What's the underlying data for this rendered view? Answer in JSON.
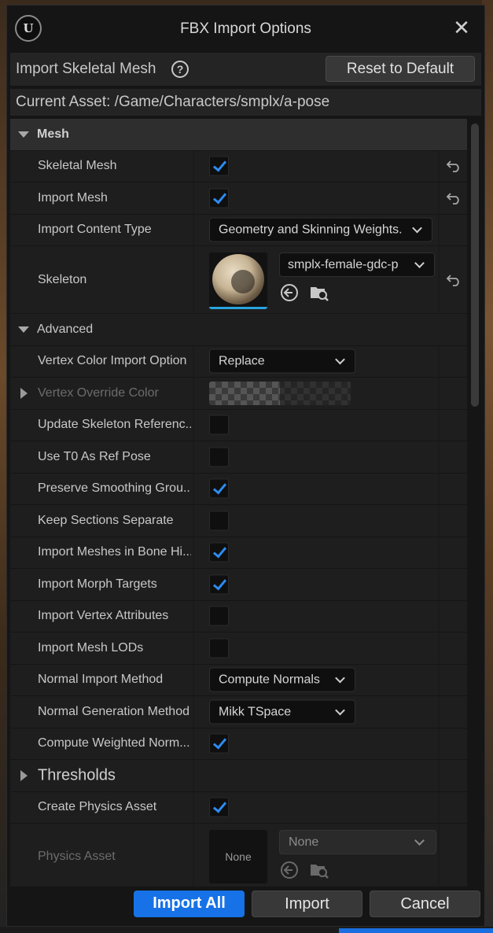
{
  "window": {
    "title": "FBX Import Options",
    "logo_letter": "U"
  },
  "header": {
    "title": "Import Skeletal Mesh",
    "reset_label": "Reset to Default"
  },
  "asset": {
    "label": "Current Asset:",
    "path": "/Game/Characters/smplx/a-pose",
    "text": "Current Asset:  /Game/Characters/smplx/a-pose"
  },
  "categories": {
    "mesh": "Mesh",
    "advanced": "Advanced",
    "thresholds": "Thresholds"
  },
  "rows": {
    "skeletal_mesh": {
      "label": "Skeletal Mesh",
      "checked": true
    },
    "import_mesh": {
      "label": "Import Mesh",
      "checked": true
    },
    "import_content_type": {
      "label": "Import Content Type",
      "value": "Geometry and Skinning Weights."
    },
    "skeleton": {
      "label": "Skeleton",
      "value": "smplx-female-gdc-p"
    },
    "vertex_color_import_option": {
      "label": "Vertex Color Import Option",
      "value": "Replace"
    },
    "vertex_override_color": {
      "label": "Vertex Override Color"
    },
    "update_skeleton_reference": {
      "label": "Update Skeleton Referenc...",
      "checked": false
    },
    "use_t0_as_ref_pose": {
      "label": "Use T0 As Ref Pose",
      "checked": false
    },
    "preserve_smoothing_groups": {
      "label": "Preserve Smoothing Grou...",
      "checked": true
    },
    "keep_sections_separate": {
      "label": "Keep Sections Separate",
      "checked": false
    },
    "import_meshes_in_bone_hierarchy": {
      "label": "Import Meshes in Bone Hi...",
      "checked": true
    },
    "import_morph_targets": {
      "label": "Import Morph Targets",
      "checked": true
    },
    "import_vertex_attributes": {
      "label": "Import Vertex Attributes",
      "checked": false
    },
    "import_mesh_lods": {
      "label": "Import Mesh LODs",
      "checked": false
    },
    "normal_import_method": {
      "label": "Normal Import Method",
      "value": "Compute Normals"
    },
    "normal_generation_method": {
      "label": "Normal Generation Method",
      "value": "Mikk TSpace"
    },
    "compute_weighted_normals": {
      "label": "Compute Weighted Norm...",
      "checked": true
    },
    "create_physics_asset": {
      "label": "Create Physics Asset",
      "checked": true
    },
    "physics_asset": {
      "label": "Physics Asset",
      "thumb_text": "None",
      "value": "None"
    }
  },
  "footer": {
    "import_all": "Import All",
    "import": "Import",
    "cancel": "Cancel"
  },
  "colors": {
    "accent": "#1672e6",
    "check": "#2d8cf0",
    "window_bg": "#151515",
    "row_bg": "#1e1e1e"
  }
}
